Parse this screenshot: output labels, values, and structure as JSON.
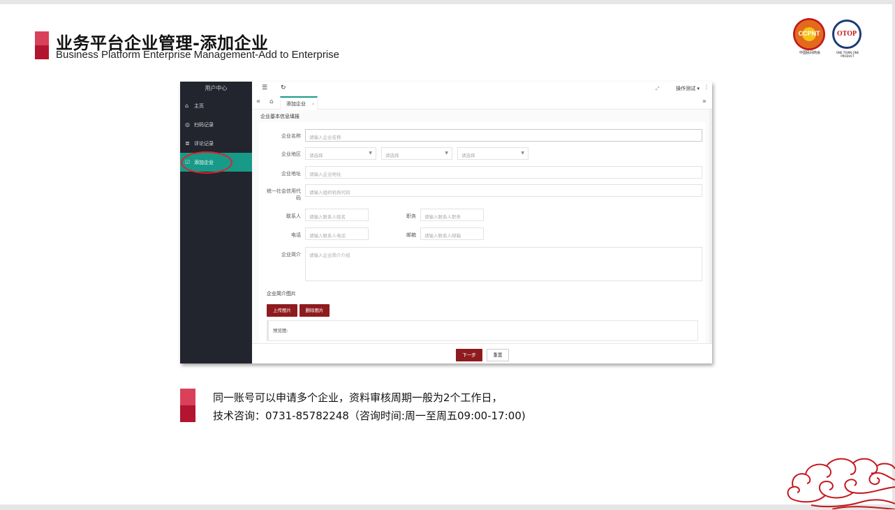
{
  "slide": {
    "title_cn": "业务平台企业管理-添加企业",
    "title_en": "Business Platform Enterprise Management-Add to Enterprise",
    "logo1_text": "CCPNT",
    "logo1_caption": "中国民间商会",
    "logo2_text": "OTOP",
    "logo2_caption": "ONE TOWN ONE PRODUCT"
  },
  "app": {
    "sidebar": {
      "title": "用户中心",
      "items": [
        {
          "label": "主页",
          "icon": "home-icon",
          "glyph": "⌂"
        },
        {
          "label": "扫码记录",
          "icon": "scan-icon",
          "glyph": "◎"
        },
        {
          "label": "评论记录",
          "icon": "comment-icon",
          "glyph": "≣"
        },
        {
          "label": "添加企业",
          "icon": "add-enterprise-icon",
          "glyph": "☑",
          "active": true
        }
      ]
    },
    "topbar": {
      "menu_icon": "☰",
      "refresh_icon": "↻",
      "fullscreen_icon": "⤢",
      "user_label": "操作测试 ▾",
      "more_icon": "⋮"
    },
    "tabs": {
      "prev_icon": "«",
      "home_icon": "⌂",
      "active_label": "添加企业",
      "close_icon": "×",
      "next_icon": "»"
    },
    "form": {
      "section_title": "企业基本信息填报",
      "name_label": "企业名称",
      "name_placeholder": "请输入企业名称",
      "region_label": "企业地区",
      "region_selects": [
        "请选择",
        "请选择",
        "请选择"
      ],
      "address_label": "企业地址",
      "address_placeholder": "请输入企业地址",
      "credit_label_1": "统一社会信用代",
      "credit_label_2": "码",
      "credit_placeholder": "请输入组织机构代码",
      "contact_label": "联系人",
      "contact_placeholder": "请输入联系人姓名",
      "position_label": "职务",
      "position_placeholder": "请输入联系人职务",
      "phone_label": "电话",
      "phone_placeholder": "请输入联系人电话",
      "email_label": "邮箱",
      "email_placeholder": "请输入联系人邮箱",
      "intro_label": "企业简介",
      "intro_placeholder": "请输入企业简介介绍",
      "image_section_title": "企业简介图片",
      "upload_button": "上传图片",
      "delete_button": "删除图片",
      "preview_label": "预览图:",
      "next_button": "下一步",
      "reset_button": "重置"
    }
  },
  "notes": {
    "line1": "同一账号可以申请多个企业，资料审核周期一般为2个工作日，",
    "line2": "技术咨询：0731-85782248（咨询时间:周一至周五09:00-17:00)"
  },
  "colors": {
    "brand_red": "#b3142f",
    "brand_pink": "#d9415b",
    "sidebar_bg": "#22252d",
    "active_teal": "#179a88",
    "button_red": "#8e1b1e",
    "annotation_red": "#e0202b"
  }
}
